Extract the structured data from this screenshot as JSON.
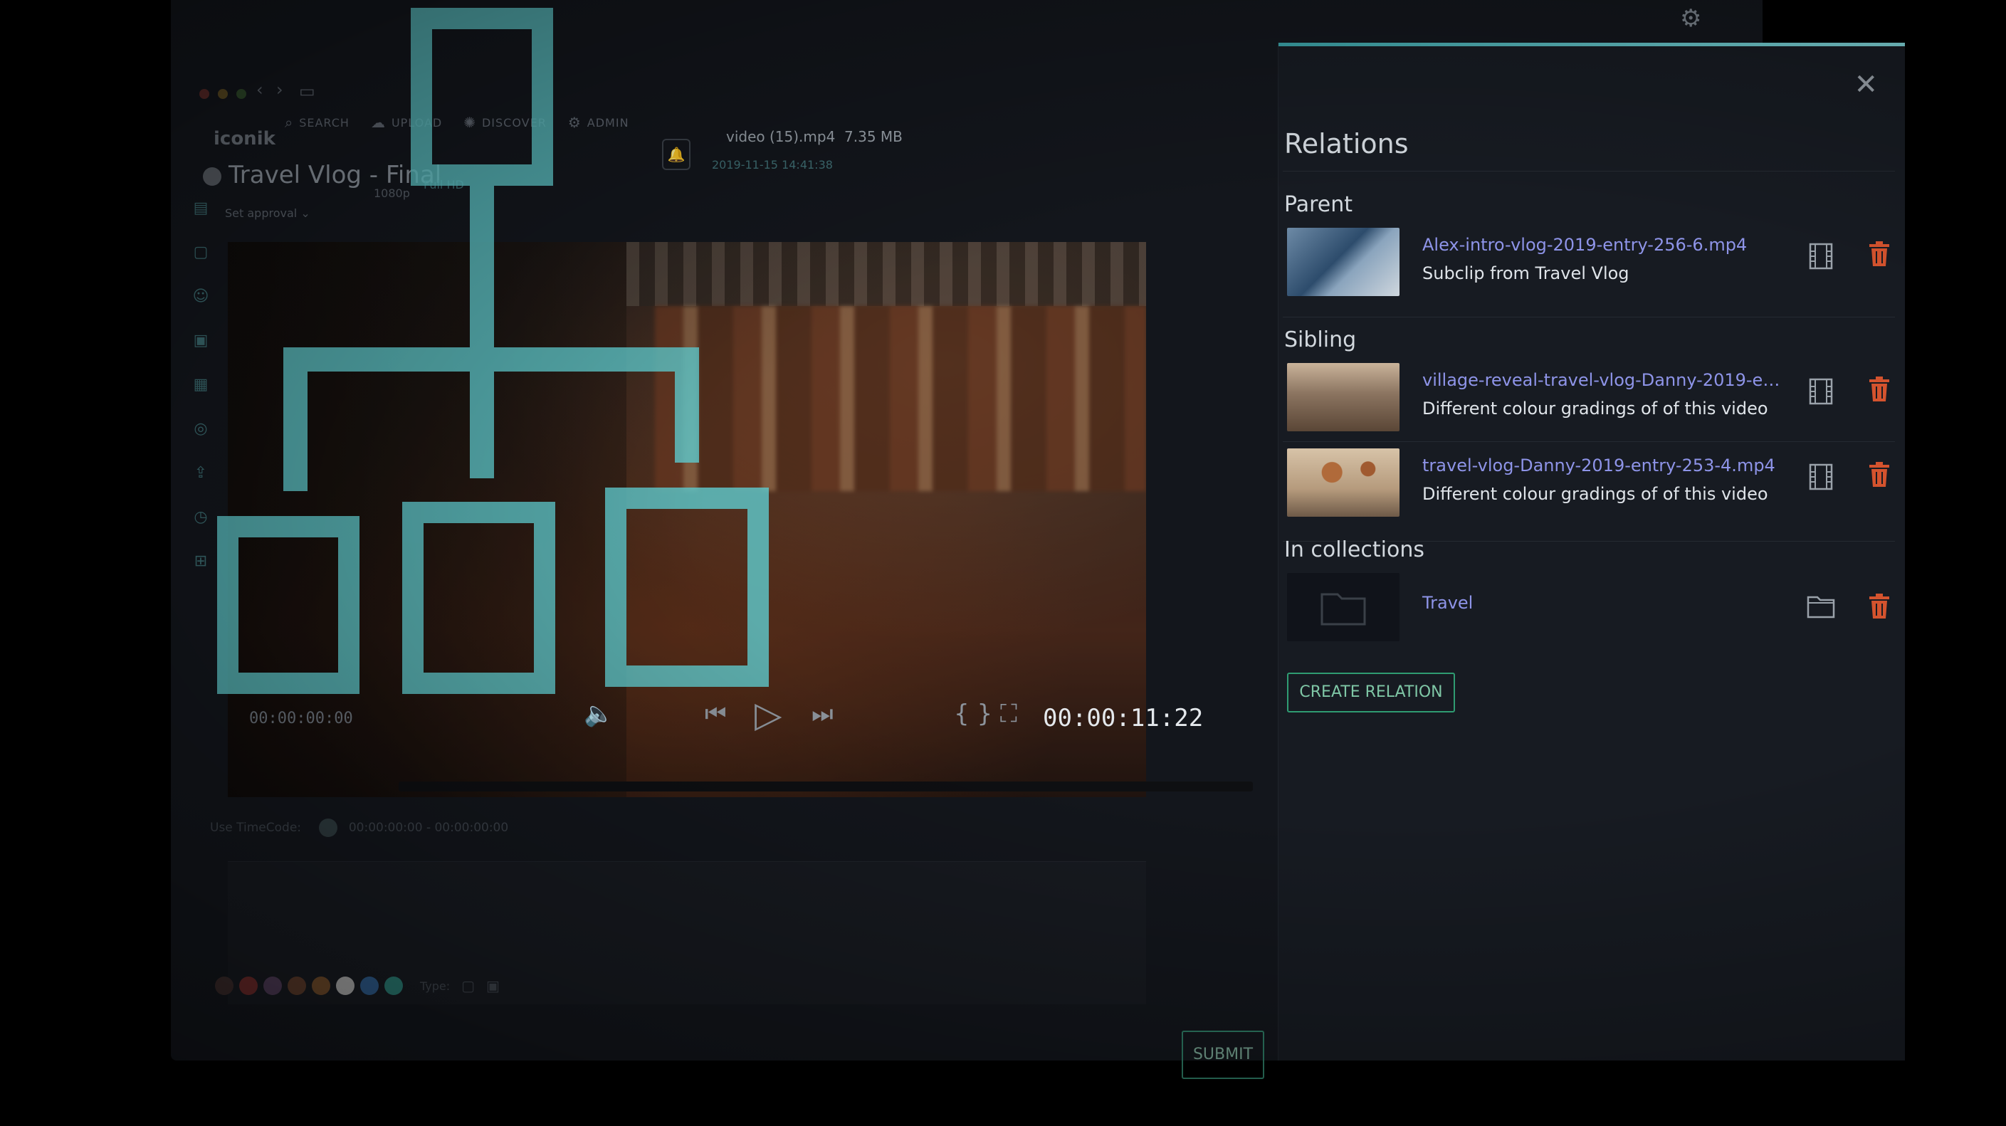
{
  "app": {
    "logo": "iconik",
    "nav": [
      {
        "label": "SEARCH",
        "icon": "search-icon"
      },
      {
        "label": "UPLOAD",
        "icon": "cloud-icon"
      },
      {
        "label": "DISCOVER",
        "icon": "discover-icon"
      },
      {
        "label": "ADMIN",
        "icon": "admin-icon"
      }
    ]
  },
  "asset": {
    "title": "Travel Vlog - Final",
    "approval": "Set approval",
    "resolution": "1080p",
    "quality": "Full HD",
    "date": "2019-11-15 14:41:38",
    "file_name": "video (15).mp4",
    "file_size": "7.35 MB"
  },
  "player": {
    "timecode_current": "00:00:00:00",
    "timecode_total": "00:00:11:22",
    "progress": 0
  },
  "comment": {
    "timecode_label": "Use TimeCode:",
    "timecode_range": "00:00:00:00 - 00:00:00:00",
    "type_label": "Type:",
    "swatch_colors": [
      "#3a2b2b",
      "#6b2a2a",
      "#4d3a55",
      "#5a3a2a",
      "#6e4a2a",
      "#a9a9a9",
      "#2e5a8a",
      "#2a7a72"
    ],
    "submit_label": "SUBMIT"
  },
  "relations": {
    "title": "Relations",
    "parent_label": "Parent",
    "sibling_label": "Sibling",
    "collections_label": "In collections",
    "parent": [
      {
        "name": "Alex-intro-vlog-2019-entry-256-6.mp4",
        "description": "Subclip from Travel Vlog"
      }
    ],
    "siblings": [
      {
        "name": "village-reveal-travel-vlog-Danny-2019-entr…",
        "description": "Different colour gradings of of this video"
      },
      {
        "name": "travel-vlog-Danny-2019-entry-253-4.mp4",
        "description": "Different colour gradings of of this video"
      }
    ],
    "collections": [
      {
        "name": "Travel"
      }
    ],
    "create_label": "CREATE RELATION"
  },
  "colors": {
    "accent": "#3aa1a6",
    "link": "#8e94e8",
    "delete": "#d4532e",
    "create": "#2f9c72"
  }
}
